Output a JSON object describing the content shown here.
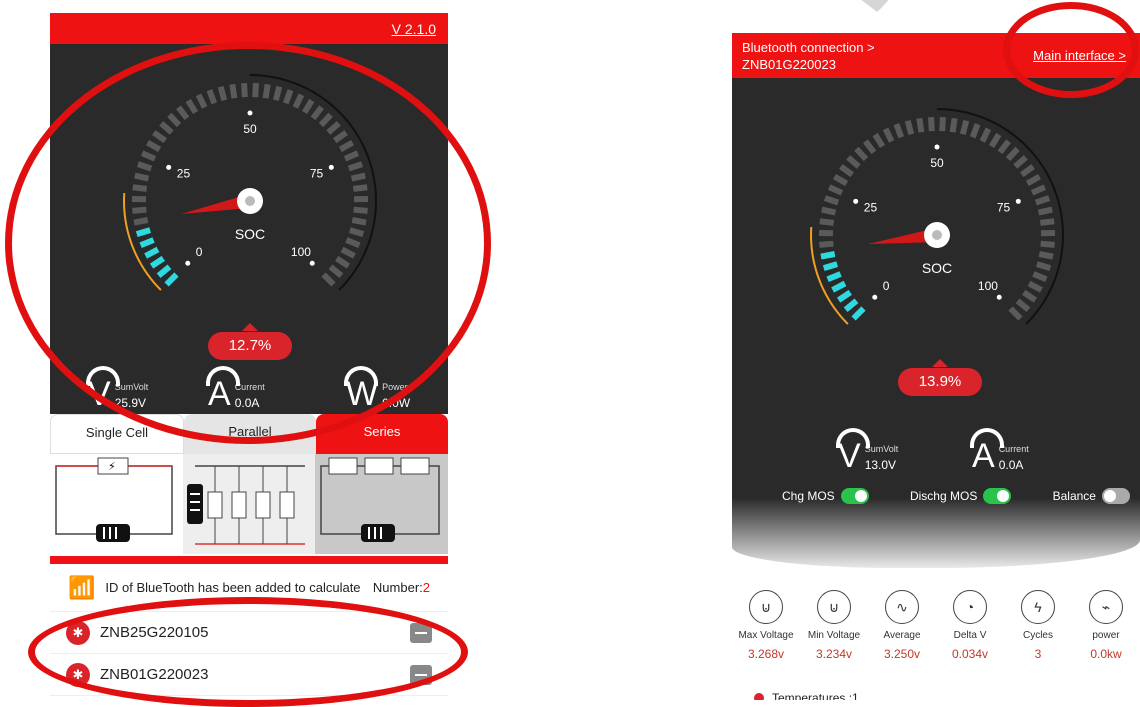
{
  "left": {
    "version": "V 2.1.0",
    "soc_label": "SOC",
    "soc_value": "12.7%",
    "soc_fraction": 0.127,
    "gauge_ticks": [
      "0",
      "25",
      "50",
      "75",
      "100"
    ],
    "metrics": [
      {
        "symbol": "V",
        "caption": "SumVolt",
        "value": "25.9V"
      },
      {
        "symbol": "A",
        "caption": "Current",
        "value": "0.0A"
      },
      {
        "symbol": "W",
        "caption": "Power",
        "value": "0.0W"
      }
    ],
    "tabs": [
      "Single Cell",
      "Parallel",
      "Series"
    ],
    "info_text": "ID of BlueTooth has been added to calculate",
    "number_label": "Number:",
    "number_value": "2",
    "devices": [
      "ZNB25G220105",
      "ZNB01G220023"
    ]
  },
  "right": {
    "connection_line1": "Bluetooth connection >",
    "connection_line2": "ZNB01G220023",
    "main_link": "Main interface >",
    "soc_label": "SOC",
    "soc_value": "13.9%",
    "soc_fraction": 0.139,
    "gauge_ticks": [
      "0",
      "25",
      "50",
      "75",
      "100"
    ],
    "metrics": [
      {
        "symbol": "V",
        "caption": "SumVolt",
        "value": "13.0V"
      },
      {
        "symbol": "A",
        "caption": "Current",
        "value": "0.0A"
      }
    ],
    "toggles": [
      {
        "label": "Chg MOS",
        "on": true
      },
      {
        "label": "Dischg MOS",
        "on": true
      },
      {
        "label": "Balance",
        "on": false
      }
    ],
    "stats": [
      {
        "label": "Max Voltage",
        "value": "3.268v"
      },
      {
        "label": "Min Voltage",
        "value": "3.234v"
      },
      {
        "label": "Average",
        "value": "3.250v"
      },
      {
        "label": "Delta V",
        "value": "0.034v"
      },
      {
        "label": "Cycles",
        "value": "3"
      },
      {
        "label": "power",
        "value": "0.0kw"
      }
    ],
    "temperatures": "Temperatures :1"
  },
  "colors": {
    "accent_red": "#ef1212",
    "gauge_cyan": "#2fd9e0",
    "gauge_orange": "#f0a020",
    "toggle_on": "#29c24a"
  }
}
